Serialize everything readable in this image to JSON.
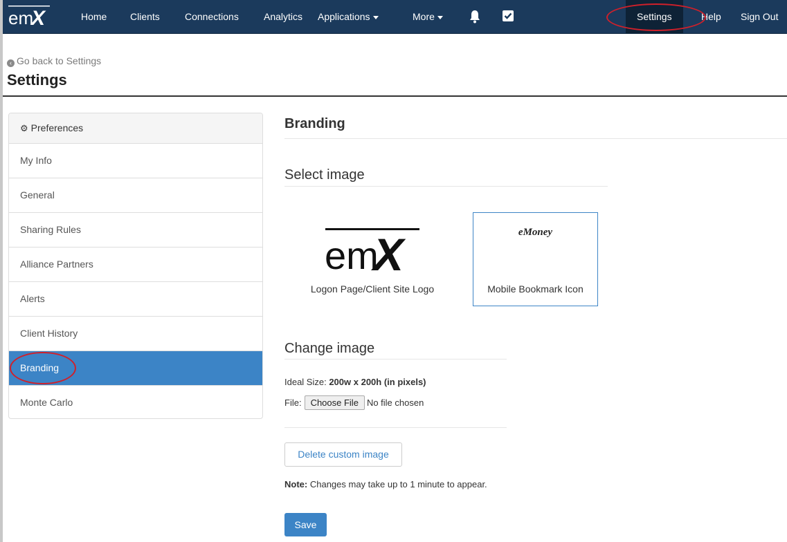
{
  "nav": {
    "brand": "emX",
    "items": [
      "Home",
      "Clients",
      "Connections",
      "Analytics",
      "Applications",
      "More"
    ],
    "icons": [
      "bell-icon",
      "checkbox-icon"
    ],
    "right": {
      "settings": "Settings",
      "help": "Help",
      "sign_out": "Sign Out"
    },
    "bg_color": "#1b3a5c"
  },
  "header": {
    "back_link": "Go back to Settings",
    "title": "Settings"
  },
  "sidebar": {
    "heading": "Preferences",
    "items": [
      {
        "label": "My Info"
      },
      {
        "label": "General"
      },
      {
        "label": "Sharing Rules"
      },
      {
        "label": "Alliance Partners"
      },
      {
        "label": "Alerts"
      },
      {
        "label": "Client History"
      },
      {
        "label": "Branding",
        "active": true
      },
      {
        "label": "Monte Carlo"
      }
    ],
    "active_color": "#3c84c6"
  },
  "main": {
    "title": "Branding",
    "select_image": {
      "heading": "Select image",
      "options": [
        {
          "caption": "Logon Page/Client Site Logo",
          "art": "emX"
        },
        {
          "caption": "Mobile Bookmark Icon",
          "art": "eMoney",
          "selected": true
        }
      ]
    },
    "change_image": {
      "heading": "Change image",
      "ideal_label": "Ideal Size:",
      "ideal_value": "200w x 200h (in pixels)",
      "file_label": "File:",
      "file_button": "Choose File",
      "file_status": "No file chosen"
    },
    "delete_button": "Delete custom image",
    "note_label": "Note:",
    "note_text": "Changes may take up to 1 minute to appear.",
    "save_button": "Save"
  },
  "annotations": {
    "highlight_color": "#d0202a"
  }
}
